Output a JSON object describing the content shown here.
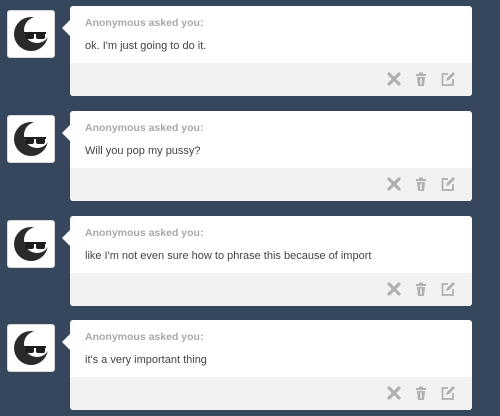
{
  "messages": [
    {
      "asker": "Anonymous asked you:",
      "question": "ok. I'm just going to do it."
    },
    {
      "asker": "Anonymous asked you:",
      "question": "Will you pop my pussy?"
    },
    {
      "asker": "Anonymous asked you:",
      "question": "like I'm not even sure how to phrase this because of import"
    },
    {
      "asker": "Anonymous asked you:",
      "question": "it's a very important thing"
    }
  ],
  "icons": {
    "avatar": "anonymous-sunglasses-avatar-icon",
    "delete": "x-delete-icon",
    "trash": "trash-icon",
    "edit": "edit-answer-icon"
  },
  "colors": {
    "dashboard_bg": "#36465d",
    "card_bg": "#ffffff",
    "footer_bg": "#f2f2f2",
    "icon": "#b0b0b0"
  }
}
